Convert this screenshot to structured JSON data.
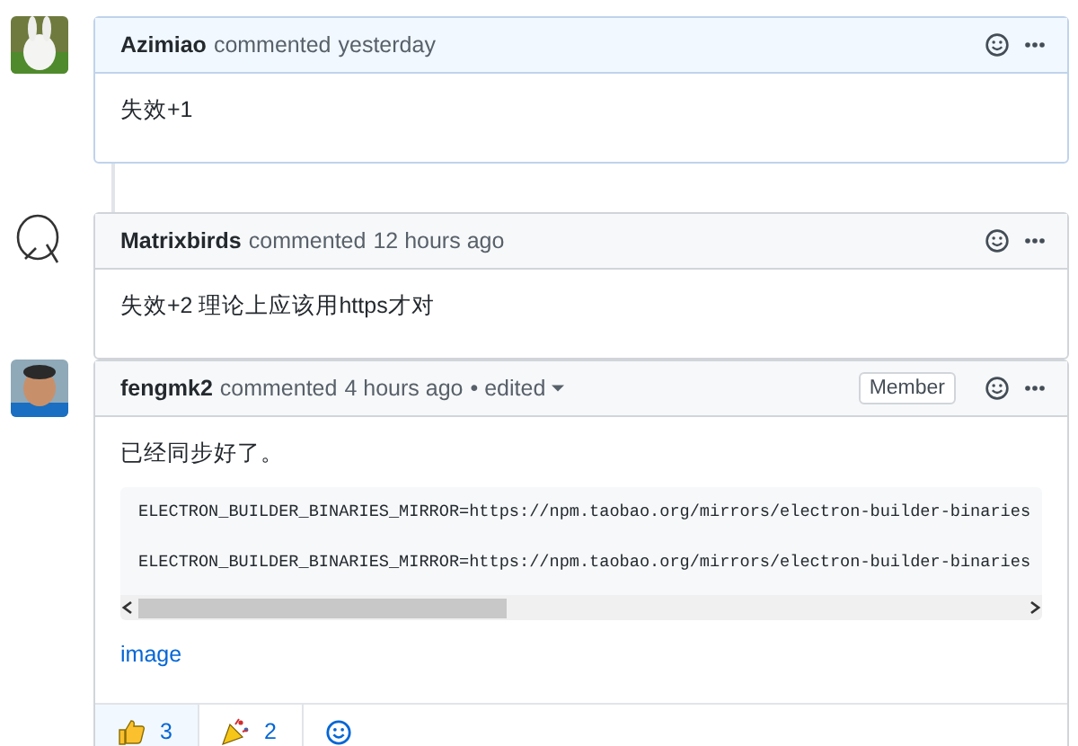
{
  "comments": [
    {
      "author": "Azimiao",
      "action": "commented",
      "time": "yesterday",
      "highlighted": true,
      "body": [
        {
          "kind": "text",
          "text": "失效+1"
        }
      ]
    },
    {
      "author": "Matrixbirds",
      "action": "commented",
      "time": "12 hours ago",
      "highlighted": false,
      "body": [
        {
          "kind": "text",
          "text": "失效+2 理论上应该用https才对"
        }
      ]
    },
    {
      "author": "fengmk2",
      "action": "commented",
      "time": "4 hours ago",
      "edited": "• edited",
      "badge": "Member",
      "highlighted": false,
      "body": [
        {
          "kind": "text",
          "text": "已经同步好了。"
        },
        {
          "kind": "code",
          "lines": [
            "ELECTRON_BUILDER_BINARIES_MIRROR=https://npm.taobao.org/mirrors/electron-builder-binaries",
            "ELECTRON_BUILDER_BINARIES_MIRROR=https://npm.taobao.org/mirrors/electron-builder-binaries"
          ]
        },
        {
          "kind": "link",
          "text": "image"
        }
      ],
      "reactions": [
        {
          "kind": "thumbs-up",
          "count": "3",
          "selected": true
        },
        {
          "kind": "party",
          "count": "2",
          "selected": false
        }
      ]
    }
  ]
}
